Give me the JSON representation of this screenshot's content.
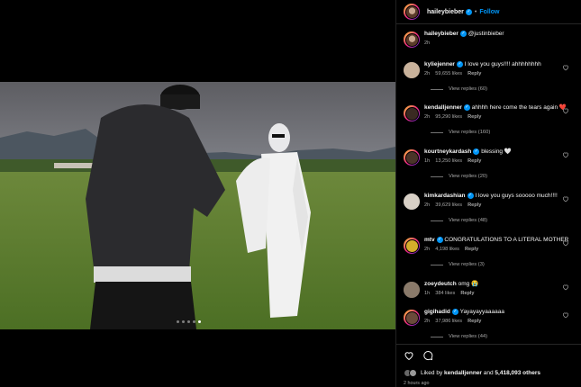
{
  "post": {
    "author": "haileybieber",
    "follow_label": "Follow",
    "separator": "•",
    "caption_mention": "@justinbieber",
    "caption_time": "2h",
    "carousel_count": 5,
    "carousel_active_index": 4
  },
  "comments": [
    {
      "user": "kyliejenner",
      "text": "I love you guys!!!! ahhhhhhhh",
      "time": "2h",
      "likes": "59,655 likes",
      "reply": "Reply",
      "view_replies": "View replies (60)"
    },
    {
      "user": "kendalljenner",
      "text": "ahhhh here come the tears again ❤️",
      "time": "2h",
      "likes": "95,290 likes",
      "reply": "Reply",
      "view_replies": "View replies (160)"
    },
    {
      "user": "kourtneykardash",
      "text": "blessing 🤍",
      "time": "1h",
      "likes": "13,250 likes",
      "reply": "Reply",
      "view_replies": "View replies (20)"
    },
    {
      "user": "kimkardashian",
      "text": "I love you guys sooooo much!!!!",
      "time": "2h",
      "likes": "39,629 likes",
      "reply": "Reply",
      "view_replies": "View replies (48)"
    },
    {
      "user": "mtv",
      "text": "CONGRATULATIONS TO A LITERAL MOTHER",
      "time": "2h",
      "likes": "4,198 likes",
      "reply": "Reply",
      "view_replies": "View replies (3)"
    },
    {
      "user": "zoeydeutch",
      "text": "omg 😭",
      "time": "1h",
      "likes": "384 likes",
      "reply": "Reply",
      "view_replies": ""
    },
    {
      "user": "gigihadid",
      "text": "Yayayayyaaaaaa",
      "time": "2h",
      "likes": "37,986 likes",
      "reply": "Reply",
      "view_replies": "View replies (44)"
    }
  ],
  "footer": {
    "liked_by_prefix": "Liked by",
    "liked_by_user": "kendalljenner",
    "and": "and",
    "others_count": "5,418,093 others",
    "time_ago": "2 hours ago"
  },
  "icons": [
    "heart-icon",
    "comment-icon",
    "verified-icon",
    "follow-dot"
  ],
  "colors": {
    "accent": "#0095f6",
    "heart": "#ff3040",
    "muted": "#a8a8a8"
  }
}
